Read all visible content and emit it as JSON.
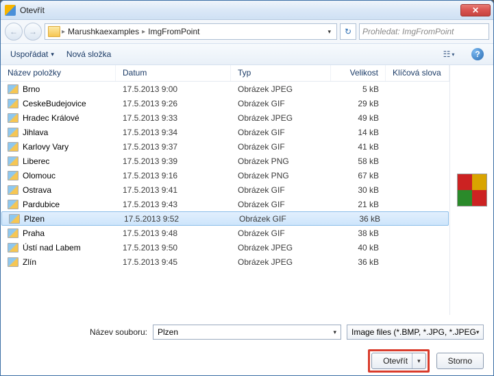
{
  "window": {
    "title": "Otevřít"
  },
  "breadcrumb": {
    "items": [
      "Marushkaexamples",
      "ImgFromPoint"
    ]
  },
  "search": {
    "placeholder": "Prohledat: ImgFromPoint"
  },
  "toolbar": {
    "organize": "Uspořádat",
    "newfolder": "Nová složka"
  },
  "columns": {
    "name": "Název položky",
    "date": "Datum",
    "type": "Typ",
    "size": "Velikost",
    "keywords": "Klíčová slova"
  },
  "files": [
    {
      "name": "Brno",
      "date": "17.5.2013 9:00",
      "type": "Obrázek JPEG",
      "size": "5 kB",
      "selected": false
    },
    {
      "name": "CeskeBudejovice",
      "date": "17.5.2013 9:26",
      "type": "Obrázek GIF",
      "size": "29 kB",
      "selected": false
    },
    {
      "name": "Hradec Králové",
      "date": "17.5.2013 9:33",
      "type": "Obrázek JPEG",
      "size": "49 kB",
      "selected": false
    },
    {
      "name": "Jihlava",
      "date": "17.5.2013 9:34",
      "type": "Obrázek GIF",
      "size": "14 kB",
      "selected": false
    },
    {
      "name": "Karlovy Vary",
      "date": "17.5.2013 9:37",
      "type": "Obrázek GIF",
      "size": "41 kB",
      "selected": false
    },
    {
      "name": "Liberec",
      "date": "17.5.2013 9:39",
      "type": "Obrázek PNG",
      "size": "58 kB",
      "selected": false
    },
    {
      "name": "Olomouc",
      "date": "17.5.2013 9:16",
      "type": "Obrázek PNG",
      "size": "67 kB",
      "selected": false
    },
    {
      "name": "Ostrava",
      "date": "17.5.2013 9:41",
      "type": "Obrázek GIF",
      "size": "30 kB",
      "selected": false
    },
    {
      "name": "Pardubice",
      "date": "17.5.2013 9:43",
      "type": "Obrázek GIF",
      "size": "21 kB",
      "selected": false
    },
    {
      "name": "Plzen",
      "date": "17.5.2013 9:52",
      "type": "Obrázek GIF",
      "size": "36 kB",
      "selected": true
    },
    {
      "name": "Praha",
      "date": "17.5.2013 9:48",
      "type": "Obrázek GIF",
      "size": "38 kB",
      "selected": false
    },
    {
      "name": "Ústí nad Labem",
      "date": "17.5.2013 9:50",
      "type": "Obrázek JPEG",
      "size": "40 kB",
      "selected": false
    },
    {
      "name": "Zlín",
      "date": "17.5.2013 9:45",
      "type": "Obrázek JPEG",
      "size": "36 kB",
      "selected": false
    }
  ],
  "filename": {
    "label": "Název souboru:",
    "value": "Plzen"
  },
  "filter": {
    "label": "Image files (*.BMP, *.JPG, *.JPEG"
  },
  "buttons": {
    "open": "Otevřít",
    "cancel": "Storno"
  }
}
